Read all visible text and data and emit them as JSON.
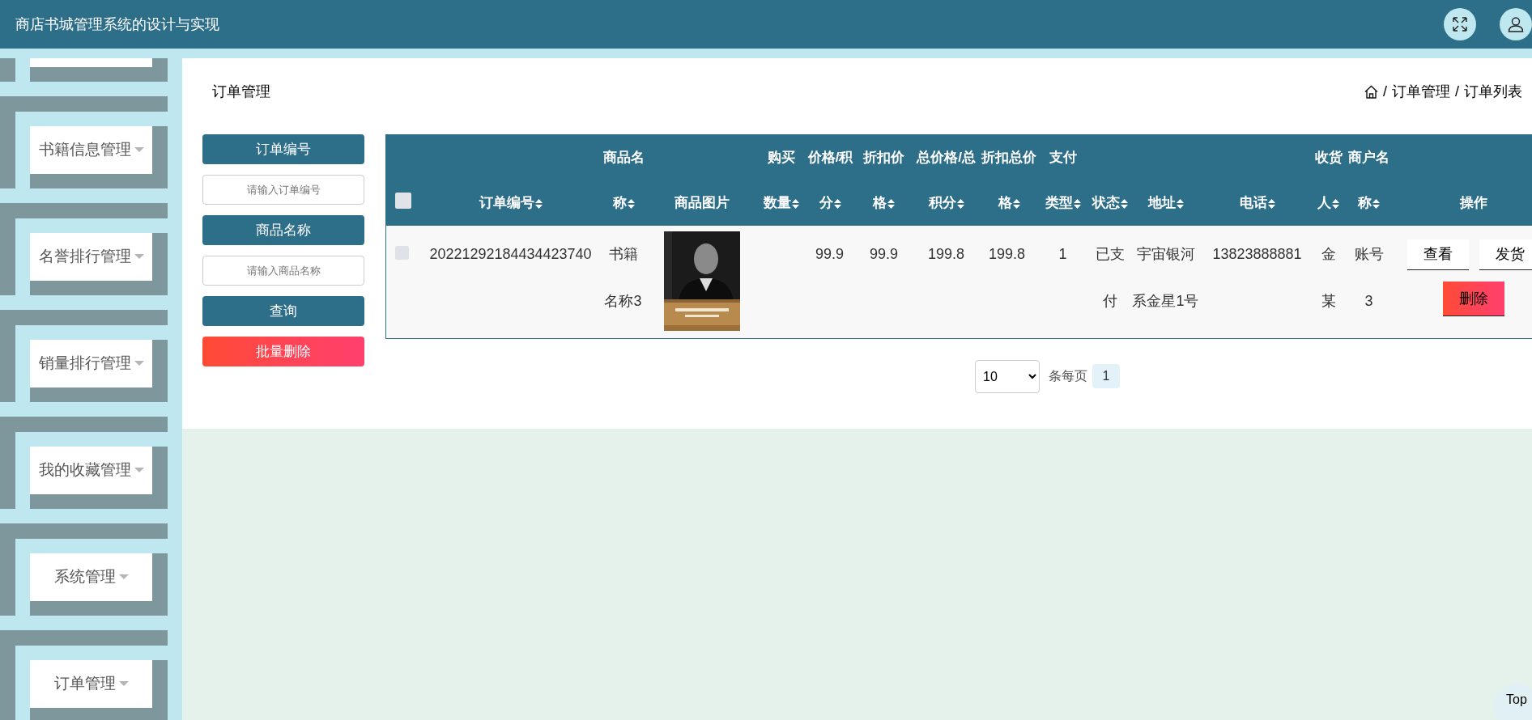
{
  "header": {
    "title": "商店书城管理系统的设计与实现"
  },
  "sidebar": {
    "items": [
      {
        "label": "书籍信息管理"
      },
      {
        "label": "名誉排行管理"
      },
      {
        "label": "销量排行管理"
      },
      {
        "label": "我的收藏管理"
      },
      {
        "label": "系统管理"
      },
      {
        "label": "订单管理"
      }
    ]
  },
  "page": {
    "title": "订单管理",
    "breadcrumb": {
      "separator": "/",
      "items": [
        "订单管理",
        "订单列表"
      ]
    }
  },
  "search": {
    "fields": [
      {
        "label": "订单编号",
        "placeholder": "请输入订单编号"
      },
      {
        "label": "商品名称",
        "placeholder": "请输入商品名称"
      }
    ],
    "buttons": [
      {
        "label": "查询",
        "kind": "primary"
      },
      {
        "label": "批量删除",
        "kind": "danger"
      }
    ]
  },
  "table": {
    "select_all": {
      "checked": false
    },
    "columns": [
      {
        "label": "订单编号",
        "sortable": true
      },
      {
        "label": "商品名称",
        "sortable": true
      },
      {
        "label": "商品图片",
        "sortable": false
      },
      {
        "label": "购买数量",
        "sortable": true
      },
      {
        "label": "价格/积分",
        "sortable": true
      },
      {
        "label": "折扣价格",
        "sortable": true
      },
      {
        "label": "总价格/总积分",
        "sortable": true
      },
      {
        "label": "折扣总价格",
        "sortable": true
      },
      {
        "label": "支付类型",
        "sortable": true
      },
      {
        "label": "状态",
        "sortable": true
      },
      {
        "label": "地址",
        "sortable": true
      },
      {
        "label": "电话",
        "sortable": true
      },
      {
        "label": "收货人",
        "sortable": true
      },
      {
        "label": "商户名称",
        "sortable": true
      },
      {
        "label": "操作",
        "sortable": false
      }
    ],
    "rows": [
      {
        "checked": false,
        "cells": [
          {
            "kind": "text",
            "text": "20221292184434423740"
          },
          {
            "kind": "text",
            "text": "书籍名称3"
          },
          {
            "kind": "picture"
          },
          {
            "kind": "blank"
          },
          {
            "kind": "text",
            "text": "99.9"
          },
          {
            "kind": "text",
            "text": "99.9"
          },
          {
            "kind": "text",
            "text": "199.8"
          },
          {
            "kind": "text",
            "text": "199.8"
          },
          {
            "kind": "text",
            "text": "1"
          },
          {
            "kind": "text",
            "text": "已支付"
          },
          {
            "kind": "text",
            "text": "宇宙银河系金星1号"
          },
          {
            "kind": "text",
            "text": "13823888881"
          },
          {
            "kind": "text",
            "text": "金某"
          },
          {
            "kind": "text",
            "text": "账号3"
          },
          {
            "kind": "actions",
            "buttons": [
              {
                "label": "查看",
                "kind": "outline"
              },
              {
                "label": "发货",
                "kind": "outline"
              },
              {
                "label": "删除",
                "kind": "danger"
              }
            ]
          }
        ]
      }
    ]
  },
  "pagination": {
    "page_size": "10",
    "unit": "条每页",
    "pages": [
      {
        "label": "1",
        "selected": true
      }
    ]
  },
  "back_to_top": {
    "label": "Top"
  }
}
